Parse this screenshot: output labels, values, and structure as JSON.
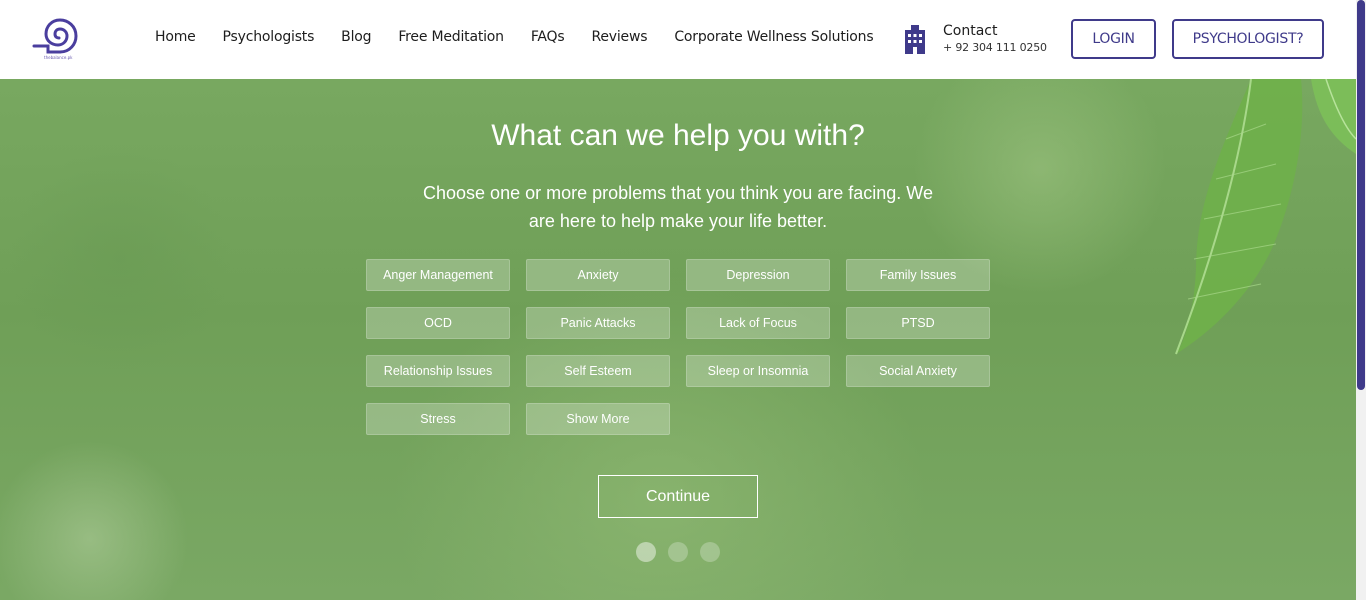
{
  "header": {
    "logo_text": "thebalance.pk",
    "nav": [
      "Home",
      "Psychologists",
      "Blog",
      "Free Meditation",
      "FAQs",
      "Reviews",
      "Corporate Wellness Solutions"
    ],
    "contact_label": "Contact",
    "contact_phone": "+ 92 304 111 0250",
    "login_label": "LOGIN",
    "psychologist_label": "PSYCHOLOGIST?"
  },
  "hero": {
    "title": "What can we help you with?",
    "subtitle": "Choose one or more problems that you think you are facing. We are here to help make your life better.",
    "problems": [
      "Anger Management",
      "Anxiety",
      "Depression",
      "Family Issues",
      "OCD",
      "Panic Attacks",
      "Lack of Focus",
      "PTSD",
      "Relationship Issues",
      "Self Esteem",
      "Sleep or Insomnia",
      "Social Anxiety",
      "Stress",
      "Show More"
    ],
    "continue_label": "Continue",
    "slide_count": 3,
    "active_slide": 0
  },
  "colors": {
    "brand": "#3f3a8a",
    "hero_green": "#78a860"
  }
}
